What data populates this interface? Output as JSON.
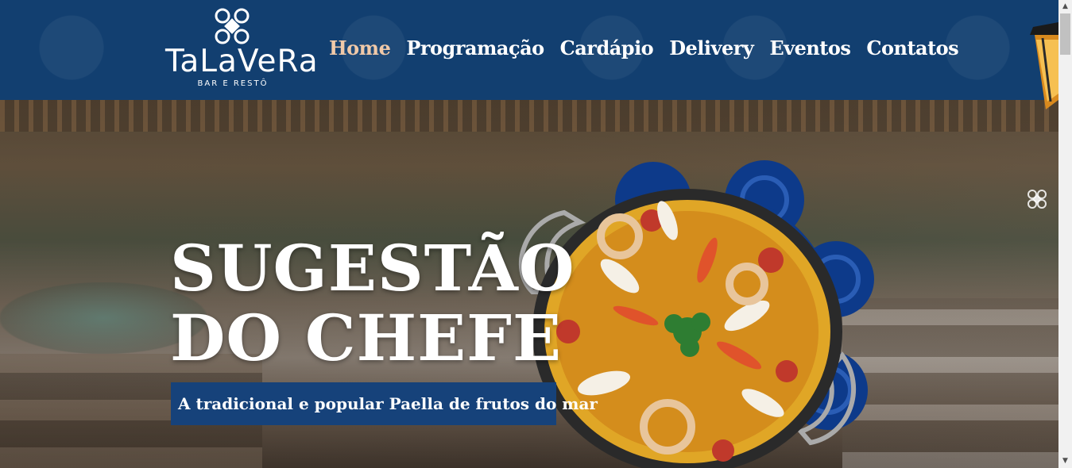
{
  "brand": {
    "name": "TaLaVeRa",
    "tagline": "BAR E RESTÔ"
  },
  "nav": {
    "items": [
      {
        "label": "Home",
        "active": true
      },
      {
        "label": "Programação",
        "active": false
      },
      {
        "label": "Cardápio",
        "active": false
      },
      {
        "label": "Delivery",
        "active": false
      },
      {
        "label": "Eventos",
        "active": false
      },
      {
        "label": "Contatos",
        "active": false
      }
    ]
  },
  "hero": {
    "title_line1": "SUGESTÃO",
    "title_line2": "DO CHEFE",
    "subtitle": "A tradicional e popular Paella de frutos do mar"
  },
  "scrollbar": {
    "up_arrow": "▲",
    "down_arrow": "▼"
  },
  "colors": {
    "header_bg": "#123f70",
    "active_nav": "#f0c9a8",
    "subtitle_bg": "#16427a",
    "ornament_blue": "#0d3a8a"
  },
  "icons": [
    "talavera-logo-icon",
    "lantern-icon",
    "ornament-icon",
    "paella-image"
  ]
}
